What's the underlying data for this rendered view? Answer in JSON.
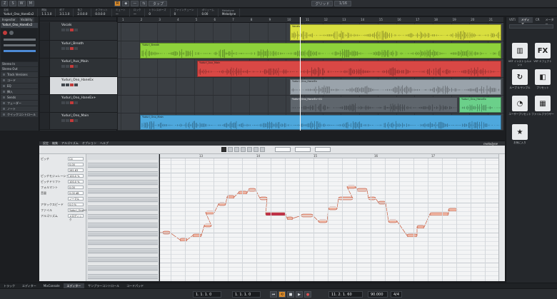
{
  "toolbar": {
    "buttons": [
      "Z",
      "S",
      "W",
      "M",
      "R",
      "◆",
      "—",
      "⇆"
    ],
    "snap_label": "グリッド",
    "quantize_label": "1/16",
    "mode_label": "タップ"
  },
  "infoline": [
    {
      "k": "名前",
      "v": "Yuduri_Ono_HaneEx2"
    },
    {
      "k": "開始",
      "v": "1.1.1.0"
    },
    {
      "k": "終了",
      "v": "3.1.1.0"
    },
    {
      "k": "長さ",
      "v": "2.0.0.0"
    },
    {
      "k": "オフセット",
      "v": "0.0.0.0"
    },
    {
      "k": "ミュート",
      "v": "—"
    },
    {
      "k": "ロック",
      "v": "—"
    },
    {
      "k": "トランスポーズ",
      "v": "0"
    },
    {
      "k": "ファインチューン",
      "v": "0"
    },
    {
      "k": "ボリューム",
      "v": "0.00"
    },
    {
      "k": "Melodyne",
      "v": "Melodyne"
    }
  ],
  "inspector": {
    "tabs": [
      "Inspector",
      "Visibility"
    ],
    "track_name": "Yuduri_Ono_HaneEx2",
    "stereo_in": "Stereo In",
    "stereo_out": "Stereo Out",
    "sections": [
      "Track Versions",
      "コード",
      "EQ",
      "挿入",
      "Sends",
      "フェーダー",
      "ノート",
      "クイックコントロール"
    ]
  },
  "tracks": [
    {
      "name": "Vocals",
      "type": "folder"
    },
    {
      "name": "Yuduri_Breath"
    },
    {
      "name": "Yuduri_Aux_Main"
    },
    {
      "name": "Yuduri_Ono_HaneEx",
      "selected": true
    },
    {
      "name": "Yuduri_Ono_HaneEx+"
    },
    {
      "name": "Yuduri_Ono_Main"
    }
  ],
  "ruler": [
    "1",
    "2",
    "3",
    "4",
    "5",
    "6",
    "7",
    "8",
    "9",
    "10",
    "11",
    "12",
    "13",
    "14",
    "15",
    "16",
    "17",
    "18",
    "19",
    "20",
    "21"
  ],
  "clips": [
    {
      "lane": 0,
      "label": "Vocals",
      "color": "#d9df3f"
    },
    {
      "lane": 1,
      "label": "Yuduri_Breath",
      "color": "#8ed23b"
    },
    {
      "lane": 2,
      "label": "Yuduri_Aux_Main",
      "color": "#d94845"
    },
    {
      "lane": 3,
      "label": "Yuduri_Ono_HaneEx",
      "color": "#9aa3ab"
    },
    {
      "lane": 4,
      "label": "Yuduri_Ono_HaneEx+01",
      "color": "#5f666d"
    },
    {
      "lane": 4,
      "label": "Yuduri_Ono_HaneEx",
      "color": "#6bd08a"
    },
    {
      "lane": 5,
      "label": "Yuduri_Ono_Main",
      "color": "#4ea8dd"
    }
  ],
  "rightzone": {
    "tabs": [
      "VSTi",
      "メディア",
      "CR",
      "メーター"
    ],
    "tiles": [
      {
        "icon": "piano",
        "caption": "VST インストゥルメント"
      },
      {
        "icon": "FX",
        "caption": "VST エフェクト"
      },
      {
        "icon": "loop",
        "caption": "ループ & サンプル"
      },
      {
        "icon": "preset",
        "caption": "プリセット"
      },
      {
        "icon": "user",
        "caption": "ユーザープリセット"
      },
      {
        "icon": "browser",
        "caption": "ファイルブラウザー"
      },
      {
        "icon": "star",
        "caption": "お気に入り"
      }
    ]
  },
  "lowerzone": {
    "menus": [
      "設定",
      "編集",
      "アルゴリズム",
      "オプション",
      "ヘルプ"
    ],
    "brand": "melodyne"
  },
  "melodyne": {
    "rows": [
      {
        "label": "ピッチ",
        "value": "C4"
      },
      {
        "label": "",
        "value": "0.00"
      },
      {
        "label": "",
        "value": "261.63"
      },
      {
        "label": "ピッチモジュレーション",
        "value": "100.0 %"
      },
      {
        "label": "ピッチドリフト",
        "value": "100.0 %"
      },
      {
        "label": "フォルマント",
        "value": "0.00"
      },
      {
        "label": "音量",
        "value": "0.00 dB"
      },
      {
        "label": "",
        "value": "ノーマル"
      },
      {
        "label": "アタックスピード",
        "value": "0.0 %"
      },
      {
        "label": "ファイル",
        "value": "Yuduri_Ono+01"
      },
      {
        "label": "アルゴリズム",
        "value": "メロディック"
      }
    ],
    "ruler": [
      "13",
      "14",
      "15",
      "16",
      "17"
    ]
  },
  "bottomtabs": [
    "トラック",
    "エディター",
    "MixConsole",
    "エディター",
    "サンプラーコントロール",
    "コードパッド"
  ],
  "transport": {
    "left_locator": "1. 1. 1. 0",
    "right_locator": "1. 1. 1. 0",
    "position": "11. 2. 1. 60",
    "tempo": "90.000",
    "signature": "4/4"
  }
}
